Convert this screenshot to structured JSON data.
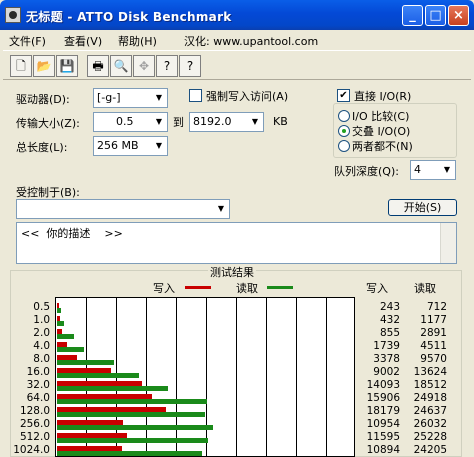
{
  "window": {
    "title": "无标题 - ATTO Disk Benchmark",
    "controls": [
      "_",
      "□",
      "×"
    ]
  },
  "menu": [
    {
      "label": "文件(F)"
    },
    {
      "label": "查看(V)"
    },
    {
      "label": "帮助(H)"
    },
    {
      "label": "汉化: www.upantool.com"
    }
  ],
  "toolbar": {
    "icons": [
      "new-icon",
      "open-icon",
      "save-icon",
      "print-icon",
      "print-preview-icon",
      "move-icon",
      "about-icon",
      "context-help-icon"
    ],
    "glyphs": [
      "🗋",
      "📂",
      "💾",
      "🖶",
      "🔍",
      "✥",
      "?",
      "?"
    ]
  },
  "settings": {
    "drive_label": "驱动器(D):",
    "drive_value": "[-g-]",
    "transfer_label": "传输大小(Z):",
    "transfer_from": "0.5",
    "to_label": "到",
    "transfer_to": "8192.0",
    "kb_label": "KB",
    "length_label": "总长度(L):",
    "length_value": "256 MB",
    "force_write_label": "强制写入访问(A)",
    "force_write_checked": false,
    "direct_io_label": "直接 I/O(R)",
    "direct_io_checked": true,
    "io_compare_label": "I/O 比较(C)",
    "overlapped_label": "交叠 I/O(O)",
    "neither_label": "两者都不(N)",
    "selected_mode": "overlapped",
    "queue_label": "队列深度(Q):",
    "queue_value": "4",
    "controlled_label": "受控制于(B):",
    "controlled_value": "",
    "start_label": "开始(S)",
    "description": "<<  你的描述    >>"
  },
  "results": {
    "title": "测试结果",
    "write_legend": "写入",
    "read_legend": "读取",
    "write_header": "写入",
    "read_header": "读取",
    "write_color": "#c80000",
    "read_color": "#1a8a1a",
    "scale_max": 25000
  },
  "chart_data": {
    "type": "bar",
    "title": "测试结果",
    "categories": [
      "0.5",
      "1.0",
      "2.0",
      "4.0",
      "8.0",
      "16.0",
      "32.0",
      "64.0",
      "128.0",
      "256.0",
      "512.0",
      "1024.0"
    ],
    "series": [
      {
        "name": "写入",
        "values": [
          243,
          432,
          855,
          1739,
          3378,
          9002,
          14093,
          15906,
          18179,
          10954,
          11595,
          10894
        ]
      },
      {
        "name": "读取",
        "values": [
          712,
          1177,
          2891,
          4511,
          9570,
          13624,
          18512,
          24918,
          24637,
          26032,
          25228,
          24205
        ]
      }
    ]
  }
}
